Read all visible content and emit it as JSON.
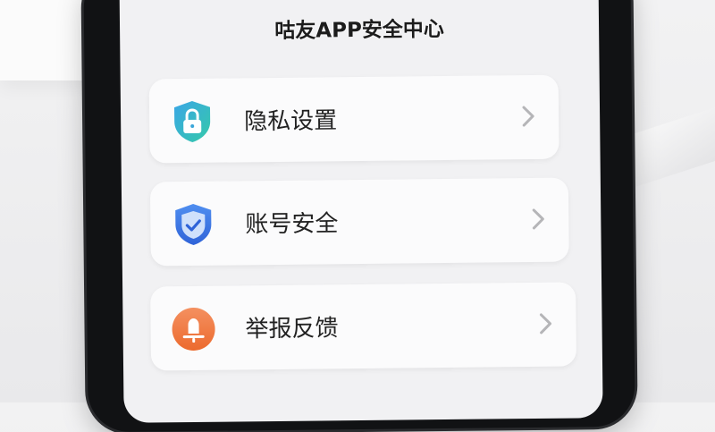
{
  "app": {
    "title": "咕友APP安全中心"
  },
  "menu": {
    "items": [
      {
        "label": "隐私设置",
        "icon": "lock-shield-icon",
        "icon_color": "#3aa6d9"
      },
      {
        "label": "账号安全",
        "icon": "check-shield-icon",
        "icon_color": "#3f7de8"
      },
      {
        "label": "举报反馈",
        "icon": "report-bell-icon",
        "icon_color": "#f07a3c"
      }
    ]
  },
  "colors": {
    "chevron": "#b5b5b8",
    "card_bg": "#fbfbfc",
    "screen_bg": "#f1f1f3",
    "frame": "#111214"
  }
}
